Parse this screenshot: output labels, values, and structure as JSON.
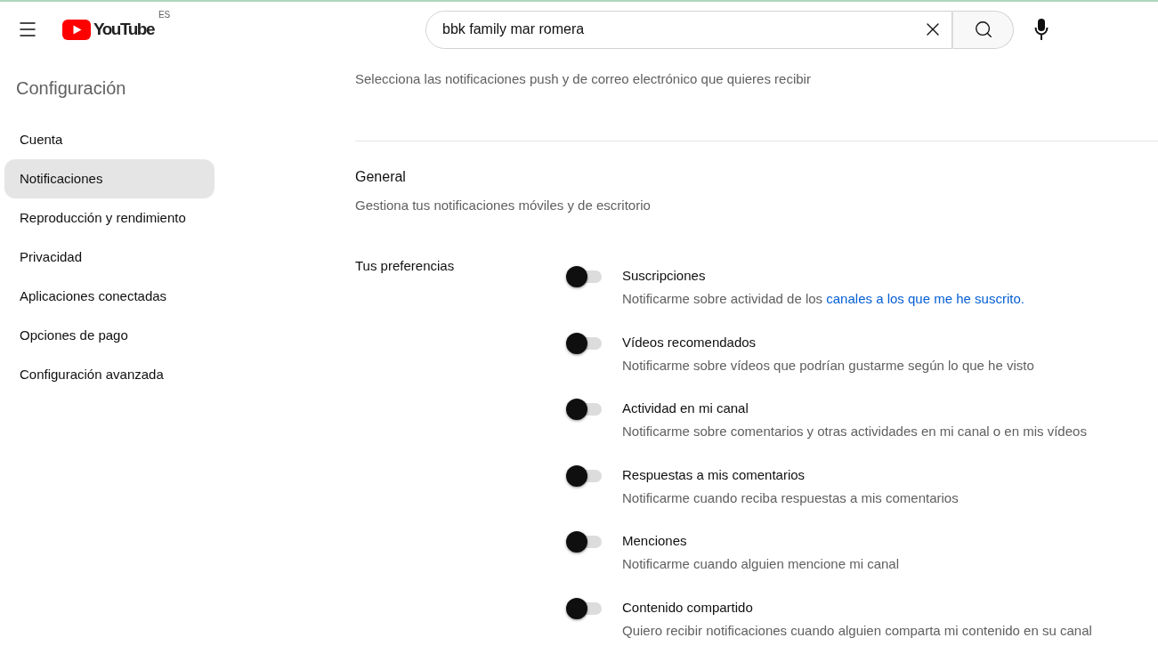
{
  "header": {
    "logo": {
      "wordmark": "YouTube",
      "region": "ES"
    },
    "search": {
      "value": "bbk family mar romera"
    }
  },
  "sidebar": {
    "title": "Configuración",
    "items": [
      {
        "label": "Cuenta",
        "selected": false
      },
      {
        "label": "Notificaciones",
        "selected": true
      },
      {
        "label": "Reproducción y rendimiento",
        "selected": false
      },
      {
        "label": "Privacidad",
        "selected": false
      },
      {
        "label": "Aplicaciones conectadas",
        "selected": false
      },
      {
        "label": "Opciones de pago",
        "selected": false
      },
      {
        "label": "Configuración avanzada",
        "selected": false
      }
    ]
  },
  "main": {
    "intro": "Selecciona las notificaciones push y de correo electrónico que quieres recibir",
    "section": {
      "title": "General",
      "subtitle": "Gestiona tus notificaciones móviles y de escritorio",
      "group_label": "Tus preferencias",
      "options": [
        {
          "title": "Suscripciones",
          "description": "Notificarme sobre actividad de los",
          "link": "canales a los que me he suscrito.",
          "on": false
        },
        {
          "title": "Vídeos recomendados",
          "description": "Notificarme sobre vídeos que podrían gustarme según lo que he visto",
          "on": false
        },
        {
          "title": "Actividad en mi canal",
          "description": "Notificarme sobre comentarios y otras actividades en mi canal o en mis vídeos",
          "on": false
        },
        {
          "title": "Respuestas a mis comentarios",
          "description": "Notificarme cuando reciba respuestas a mis comentarios",
          "on": false
        },
        {
          "title": "Menciones",
          "description": "Notificarme cuando alguien mencione mi canal",
          "on": false
        },
        {
          "title": "Contenido compartido",
          "description": "Quiero recibir notificaciones cuando alguien comparta mi contenido en su canal",
          "on": false
        }
      ]
    }
  }
}
